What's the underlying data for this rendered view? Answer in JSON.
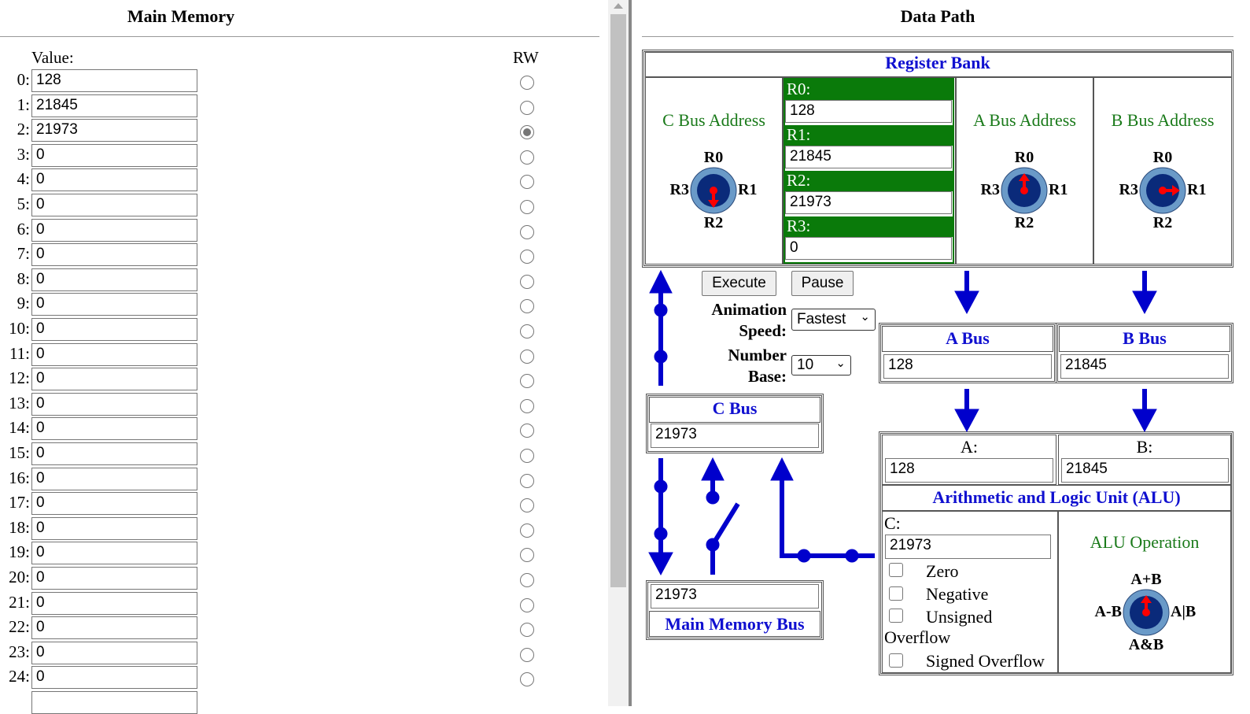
{
  "memory": {
    "title": "Main Memory",
    "value_label": "Value:",
    "rw_label": "RW",
    "selected_index": 2,
    "rows": [
      {
        "index": "0:",
        "value": "128"
      },
      {
        "index": "1:",
        "value": "21845"
      },
      {
        "index": "2:",
        "value": "21973"
      },
      {
        "index": "3:",
        "value": "0"
      },
      {
        "index": "4:",
        "value": "0"
      },
      {
        "index": "5:",
        "value": "0"
      },
      {
        "index": "6:",
        "value": "0"
      },
      {
        "index": "7:",
        "value": "0"
      },
      {
        "index": "8:",
        "value": "0"
      },
      {
        "index": "9:",
        "value": "0"
      },
      {
        "index": "10:",
        "value": "0"
      },
      {
        "index": "11:",
        "value": "0"
      },
      {
        "index": "12:",
        "value": "0"
      },
      {
        "index": "13:",
        "value": "0"
      },
      {
        "index": "14:",
        "value": "0"
      },
      {
        "index": "15:",
        "value": "0"
      },
      {
        "index": "16:",
        "value": "0"
      },
      {
        "index": "17:",
        "value": "0"
      },
      {
        "index": "18:",
        "value": "0"
      },
      {
        "index": "19:",
        "value": "0"
      },
      {
        "index": "20:",
        "value": "0"
      },
      {
        "index": "21:",
        "value": "0"
      },
      {
        "index": "22:",
        "value": "0"
      },
      {
        "index": "23:",
        "value": "0"
      },
      {
        "index": "24:",
        "value": "0"
      }
    ]
  },
  "datapath": {
    "title": "Data Path",
    "register_bank": {
      "title": "Register Bank",
      "c_bus_address": "C Bus Address",
      "a_bus_address": "A Bus Address",
      "b_bus_address": "B Bus Address",
      "registers": [
        {
          "label": "R0:",
          "value": "128"
        },
        {
          "label": "R1:",
          "value": "21845"
        },
        {
          "label": "R2:",
          "value": "21973"
        },
        {
          "label": "R3:",
          "value": "0"
        }
      ],
      "dial_labels": {
        "top": "R0",
        "left": "R3",
        "right": "R1",
        "bottom": "R2"
      },
      "c_dial_selected": "R2",
      "a_dial_selected": "R0",
      "b_dial_selected": "R1"
    },
    "controls": {
      "execute": "Execute",
      "pause": "Pause",
      "animation_speed_label_1": "Animation",
      "animation_speed_label_2": "Speed:",
      "animation_speed_value": "Fastest",
      "number_base_label_1": "Number",
      "number_base_label_2": "Base:",
      "number_base_value": "10"
    },
    "a_bus": {
      "title": "A Bus",
      "value": "128"
    },
    "b_bus": {
      "title": "B Bus",
      "value": "21845"
    },
    "c_bus": {
      "title": "C Bus",
      "value": "21973"
    },
    "main_memory_bus": {
      "title": "Main Memory Bus",
      "value": "21973"
    },
    "alu": {
      "title": "Arithmetic and Logic Unit (ALU)",
      "a_label": "A:",
      "a_value": "128",
      "b_label": "B:",
      "b_value": "21845",
      "c_label": "C:",
      "c_value": "21973",
      "flags": [
        "Zero",
        "Negative",
        "Unsigned",
        "Signed Overflow"
      ],
      "overflow_word": "Overflow",
      "operation_label": "ALU Operation",
      "op_labels": {
        "top": "A+B",
        "left": "A-B",
        "right": "A|B",
        "bottom": "A&B"
      },
      "selected_op": "A+B"
    }
  },
  "colors": {
    "accent_blue": "#1010d0",
    "register_green": "#0a7a0a",
    "arrow_red": "#ff0000",
    "dial_ring": "#6a9ac8",
    "dial_core": "#0a2a7a"
  }
}
